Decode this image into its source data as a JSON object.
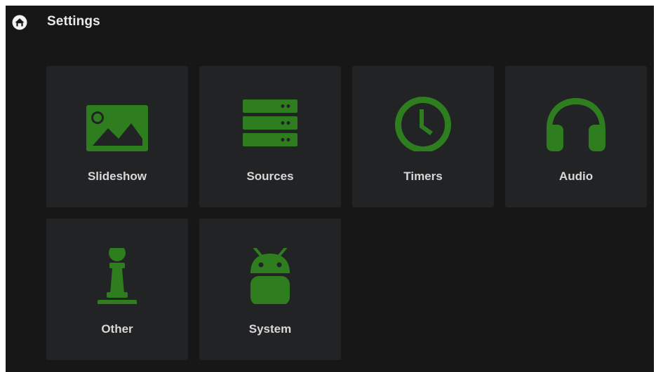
{
  "header": {
    "title": "Settings",
    "home_icon": "home-icon"
  },
  "tiles": [
    {
      "label": "Slideshow",
      "icon": "image-icon"
    },
    {
      "label": "Sources",
      "icon": "server-icon"
    },
    {
      "label": "Timers",
      "icon": "clock-icon"
    },
    {
      "label": "Audio",
      "icon": "headphones-icon"
    },
    {
      "label": "Other",
      "icon": "chess-pawn-icon"
    },
    {
      "label": "System",
      "icon": "android-icon"
    }
  ],
  "colors": {
    "background": "#161616",
    "tile": "#222325",
    "icon_accent": "#2e7d1f",
    "text": "#d8d8d8"
  }
}
